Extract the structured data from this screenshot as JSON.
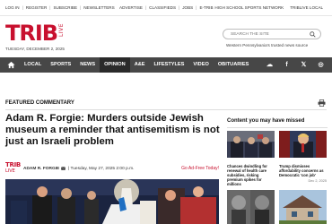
{
  "topbar": {
    "left": [
      "LOG IN",
      "REGISTER",
      "SUBSCRIBE",
      "NEWSLETTERS"
    ],
    "mid": [
      "ADVERTISE",
      "CLASSIFIEDS",
      "JOBS",
      "E-TRIB"
    ],
    "right": [
      "HIGH SCHOOL SPORTS NETWORK",
      "TRIBLIVE LOCAL"
    ]
  },
  "brand": {
    "name": "TRIB",
    "sub": "LIVE",
    "color": "#c8102e"
  },
  "dateline": "TUESDAY, DECEMBER 2, 2025",
  "search": {
    "placeholder": "SEARCH THE SITE",
    "icon": "search-icon"
  },
  "tagline": "Western Pennsylvania's trusted news source",
  "nav": {
    "items": [
      "LOCAL",
      "SPORTS",
      "NEWS",
      "OPINION",
      "A&E",
      "LIFESTYLES",
      "VIDEO",
      "OBITUARIES"
    ],
    "active": "OPINION",
    "socials": [
      "weather-icon",
      "facebook-icon",
      "x-icon",
      "instagram-icon"
    ],
    "socials_glyph": [
      "☁",
      "f",
      "𝕏",
      "◎"
    ],
    "bg": "#474747"
  },
  "article": {
    "section": "FEATURED COMMENTARY",
    "headline": "Adam R. Forgie: Murders outside Jewish museum a reminder that antisemitism is not just an Israeli problem",
    "byline": {
      "logo_main": "TRIB",
      "logo_sub": "LIVE",
      "author": "ADAM R. FORGIE",
      "date": "| Tuesday, May 27, 2025 2:00 p.m.",
      "ad": "Go Ad-Free Today!"
    }
  },
  "sidebar": {
    "title": "Content you may have missed",
    "cards": [
      {
        "caption": "Chances dwindling for renewal of health care subsidies, risking premium spikes for millions",
        "date": ""
      },
      {
        "caption": "Trump dismisses affordability concerns as Democratic 'con job'",
        "date": "Dec 2, 2025"
      }
    ]
  }
}
